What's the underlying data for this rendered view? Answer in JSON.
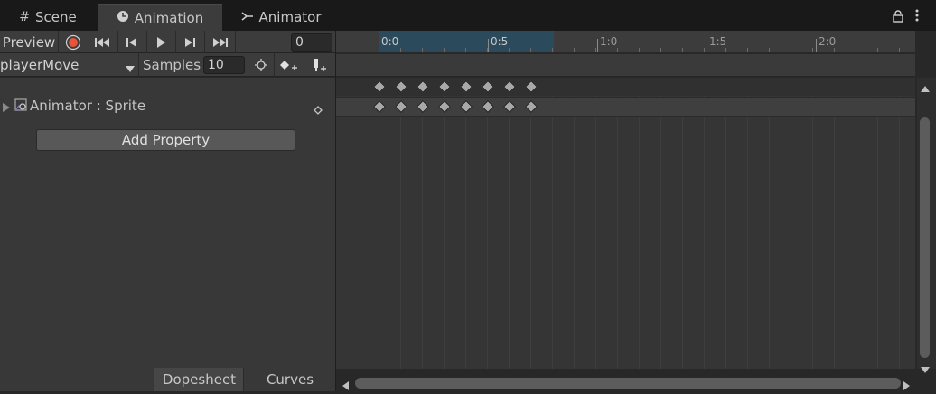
{
  "tabs": [
    {
      "label": "Scene",
      "icon": "grid-icon"
    },
    {
      "label": "Animation",
      "icon": "clock-icon"
    },
    {
      "label": "Animator",
      "icon": "animator-icon"
    }
  ],
  "toolbar": {
    "preview_label": "Preview",
    "frame_value": "0"
  },
  "clip": {
    "name": "playerMove",
    "samples_label": "Samples",
    "samples_value": "10"
  },
  "timeline": {
    "ticks": [
      {
        "label": "0:0"
      },
      {
        "label": "0:5"
      },
      {
        "label": "1:0"
      },
      {
        "label": "1:5"
      },
      {
        "label": "2:0"
      }
    ],
    "keyframe_count": 8
  },
  "properties": [
    {
      "label": "Animator : Sprite"
    }
  ],
  "add_property_label": "Add Property",
  "bottom_tabs": {
    "dopesheet": "Dopesheet",
    "curves": "Curves"
  },
  "colors": {
    "record": "#e8543a",
    "selection": "#2b4a5c"
  }
}
